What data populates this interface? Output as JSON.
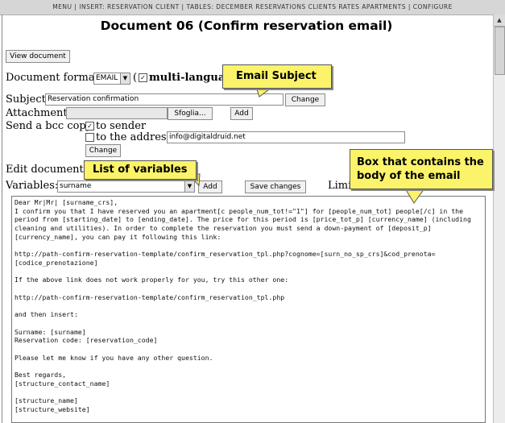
{
  "menu": {
    "text": "MENU | INSERT: RESERVATION CLIENT | TABLES: DECEMBER RESERVATIONS CLIENTS RATES APARTMENTS | CONFIGURE"
  },
  "page": {
    "title": "Document 06 (Confirm reservation email)"
  },
  "view_button": "View document",
  "format": {
    "label": "Document format:",
    "value": "EMAIL",
    "paren": "(",
    "multi_label": "multi-languag"
  },
  "subject": {
    "label": "Subject:",
    "value": "Reservation confirmation",
    "change_label": "Change"
  },
  "attachment": {
    "label": "Attachment:",
    "browse_label": "Sfoglia...",
    "add_label": "Add"
  },
  "bcc": {
    "label": "Send a bcc copy:",
    "to_sender": "to sender",
    "to_address": "to the address",
    "address_value": "info@digitaldruid.net",
    "change_label": "Change"
  },
  "edit_label": "Edit document in",
  "variables": {
    "label": "Variables:",
    "value": "surname",
    "add_label": "Add",
    "save_label": "Save changes",
    "limit_label": "Limit"
  },
  "callouts": {
    "email_subject": "Email Subject",
    "list_of_variables": "List of variables",
    "box_body_line1": "Box that contains the",
    "box_body_line2": "body of the email"
  },
  "email_body": "Dear Mr|Mr| [surname_crs],\nI confirm you that I have reserved you an apartment[c people_num_tot!=\"1\"] for [people_num_tot] people[/c] in the\nperiod from [starting_date] to [ending_date]. The price for this period is [price_tot_p] [currency_name] (including\ncleaning and utilities). In order to complete the reservation you must send a down-payment of [deposit_p]\n[currency_name], you can pay it following this link:\n\nhttp://path-confirm-reservation-template/confirm_reservation_tpl.php?cognome=[surn_no_sp_crs]&cod_prenota=\n[codice_prenotazione]\n\nIf the above link does not work properly for you, try this other one:\n\nhttp://path-confirm-reservation-template/confirm_reservation_tpl.php\n\nand then insert:\n\nSurname: [surname]\nReservation code: [reservation_code]\n\nPlease let me know if you have any other question.\n\nBest regards,\n[structure_contact_name]\n\n[structure_name]\n[structure_website]"
}
